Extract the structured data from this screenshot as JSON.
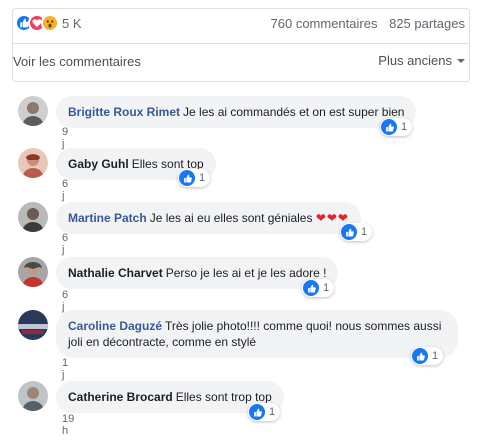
{
  "stats": {
    "reaction_icons": [
      "like-icon",
      "heart-icon",
      "wow-icon"
    ],
    "reaction_count": "5 K",
    "comments_count": "760 commentaires",
    "shares_count": "825 partages"
  },
  "comments_bar": {
    "view_label": "Voir les commentaires",
    "sort_label": "Plus anciens"
  },
  "colors": {
    "link": "#385898",
    "like": "#1877f2",
    "heart": "#f33e58",
    "bubble": "#f2f3f5"
  },
  "comments": [
    {
      "author": "Brigitte Roux Rimet",
      "text": "Je les ai commandés et on est super bien",
      "time": "9 j",
      "likes": "1"
    },
    {
      "author": "Gaby Guhl",
      "text": "Elles sont top",
      "time": "6 j",
      "likes": "1"
    },
    {
      "author": "Martine Patch",
      "text": "Je les ai eu elles sont géniales",
      "emoji": "❤❤❤",
      "time": "6 j",
      "likes": "1"
    },
    {
      "author": "Nathalie Charvet",
      "text": "Perso je les ai et je les adore !",
      "time": "6 j",
      "likes": "1"
    },
    {
      "author": "Caroline Daguzé",
      "text": "Très jolie photo!!!! comme quoi! nous sommes aussi joli en décontracte, comme en stylé",
      "time": "1 j",
      "likes": "1"
    },
    {
      "author": "Catherine Brocard",
      "text": "Elles sont trop top",
      "time": "19 h",
      "likes": "1"
    }
  ]
}
